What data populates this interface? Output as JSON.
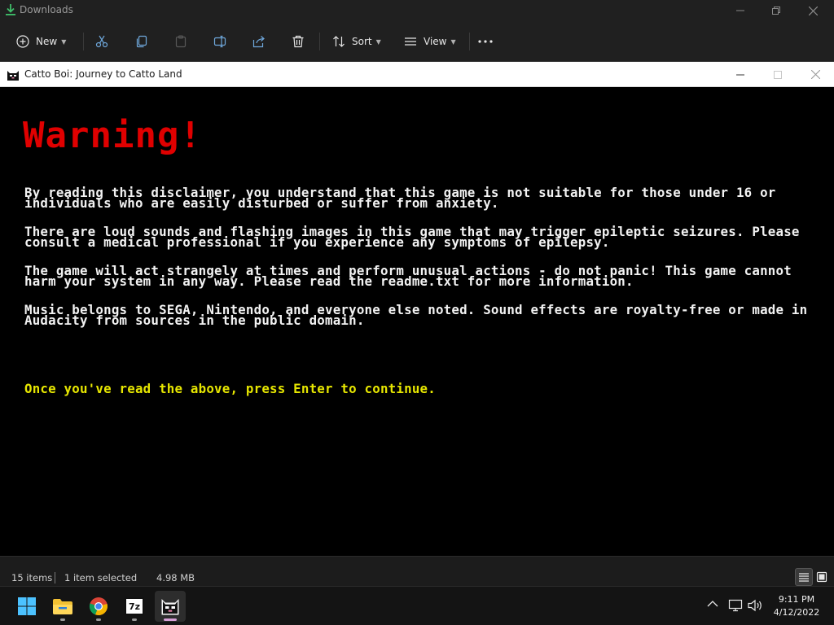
{
  "explorer": {
    "title": "Downloads",
    "toolbar": {
      "new_label": "New",
      "sort_label": "Sort",
      "view_label": "View"
    },
    "status": {
      "item_count": "15 items",
      "selection": "1 item selected",
      "selection_size": "4.98 MB"
    }
  },
  "game_window": {
    "title": "Catto Boi: Journey to Catto Land",
    "heading": "Warning!",
    "paragraphs": [
      "By reading this disclaimer, you understand that this game is not suitable for those under 16 or individuals who are easily disturbed or suffer from anxiety.",
      "There are loud sounds and flashing images in this game that may trigger epileptic seizures. Please consult a medical professional if you experience any symptoms of epilepsy.",
      "The game will act strangely at times and perform unusual actions - do not panic! This game cannot harm your system in any way. Please read the readme.txt for more information.",
      "Music belongs to SEGA, Nintendo, and everyone else noted. Sound effects are royalty-free or made in Audacity from sources in the public domain."
    ],
    "continue_prompt": "Once you've read the above, press Enter to continue.",
    "colors": {
      "heading": "#e00000",
      "body": "#f2f2f2",
      "prompt": "#e6e600",
      "background": "#000000"
    }
  },
  "taskbar": {
    "apps": [
      "start-icon",
      "file-explorer-icon",
      "chrome-icon",
      "7zip-icon",
      "catto-boi-icon"
    ],
    "sevenzip_label": "7z",
    "clock": {
      "time": "9:11 PM",
      "date": "4/12/2022"
    }
  }
}
